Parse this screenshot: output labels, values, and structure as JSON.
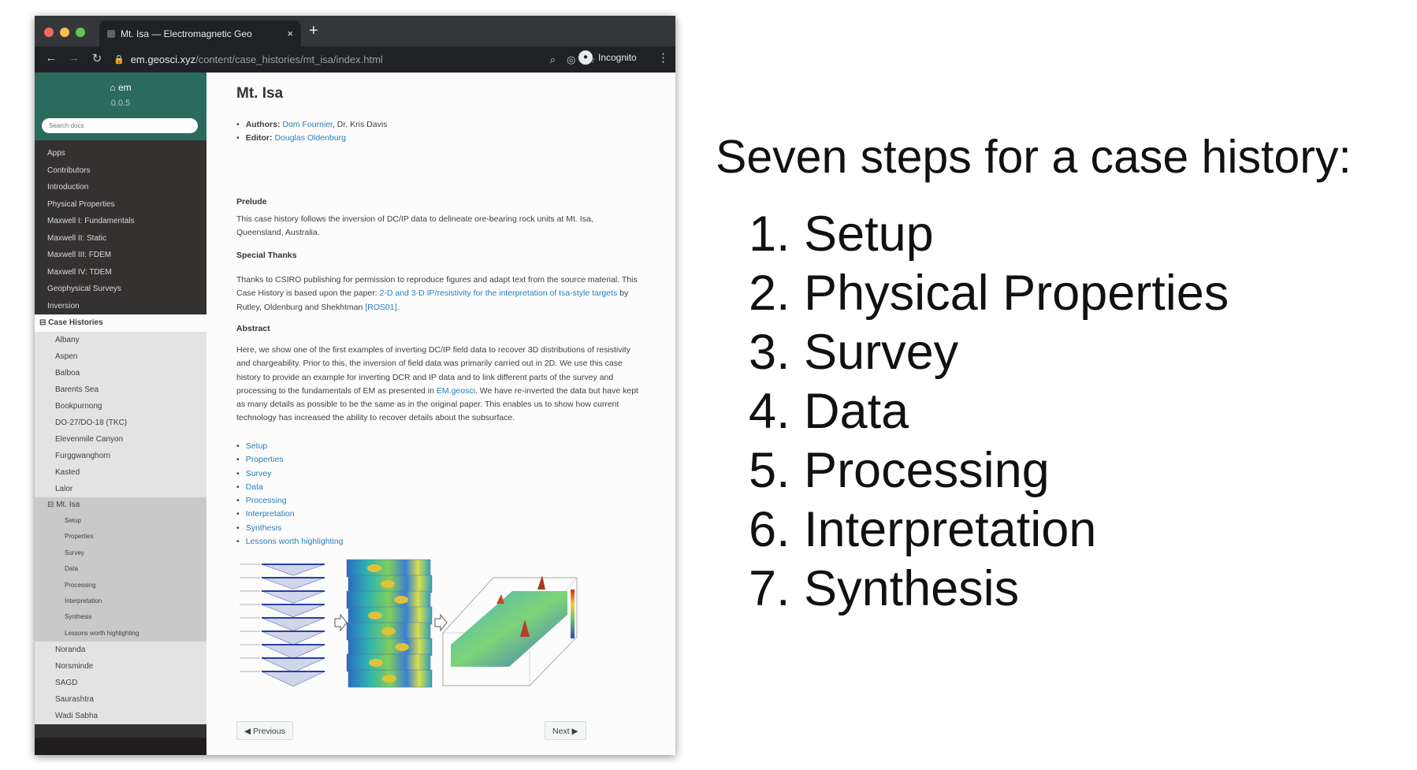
{
  "browser": {
    "tab_title": "Mt. Isa — Electromagnetic Geo",
    "tab_close": "×",
    "new_tab": "+",
    "url_host": "em.geosci.xyz",
    "url_path": "/content/case_histories/mt_isa/index.html",
    "incognito_label": "Incognito",
    "light_colors": [
      "#ed6a5e",
      "#f5bf4f",
      "#61c554"
    ]
  },
  "sidebar": {
    "home_label": "em",
    "version": "0.0.5",
    "search_placeholder": "Search docs",
    "top_items": [
      "Apps",
      "Contributors",
      "Introduction",
      "Physical Properties",
      "Maxwell I: Fundamentals",
      "Maxwell II: Static",
      "Maxwell III: FDEM",
      "Maxwell IV: TDEM",
      "Geophysical Surveys",
      "Inversion"
    ],
    "case_histories_label": "Case Histories",
    "case_items_before": [
      "Albany",
      "Aspen",
      "Balboa",
      "Barents Sea",
      "Bookpurnong",
      "DO-27/DO-18 (TKC)",
      "Elevenmile Canyon",
      "Furggwanghorn",
      "Kasted",
      "Lalor"
    ],
    "active_case": "Mt. Isa",
    "active_sub": [
      "Setup",
      "Properties",
      "Survey",
      "Data",
      "Processing",
      "Interpretation",
      "Synthesis",
      "Lessons worth highlighting"
    ],
    "case_items_after": [
      "Noranda",
      "Norsminde",
      "SAGD",
      "Saurashtra",
      "Wadi Sabha"
    ]
  },
  "content": {
    "title": "Mt. Isa",
    "authors_label": "Authors:",
    "author_1": "Dom Fournier",
    "author_sep": ",",
    "author_2": " Dr. Kris Davis",
    "editor_label": "Editor:",
    "editor": "Douglas Oldenburg",
    "prelude_heading": "Prelude",
    "prelude_text": "This case history follows the inversion of DC/IP data to delineate ore-bearing rock units at Mt. Isa, Queensland, Australia.",
    "thanks_heading": "Special Thanks",
    "thanks_pre": "Thanks to CSIRO publishing for permission to reproduce figures and adapt text from the source material. This Case History is based upon the paper: ",
    "thanks_link": "2-D and 3-D IP/resistivity for the interpretation of Isa-style targets",
    "thanks_mid": " by Rutley, Oldenburg and Shekhtman ",
    "thanks_ref": "[ROS01]",
    "thanks_end": ".",
    "abstract_heading": "Abstract",
    "abstract_pre": "Here, we show one of the first examples of inverting DC/IP field data to recover 3D distributions of resistivity and chargeability. Prior to this, the inversion of field data was primarily carried out in 2D. We use this case history to provide an example for inverting DCR and IP data and to link different parts of the survey and processing to the fundamentals of EM as presented in ",
    "abstract_link": "EM.geosci",
    "abstract_post": ". We have re-inverted the data but have kept as many details as possible to be the same as in the original paper. This enables us to show how current technology has increased the ability to recover details about the subsurface.",
    "toc": [
      "Setup",
      "Properties",
      "Survey",
      "Data",
      "Processing",
      "Interpretation",
      "Synthesis",
      "Lessons worth highlighting"
    ],
    "prev_label": "Previous",
    "next_label": "Next"
  },
  "slide": {
    "title": "Seven steps for a case history:",
    "steps": [
      "1. Setup",
      "2. Physical Properties",
      "3. Survey",
      "4. Data",
      "5. Processing",
      "6. Interpretation",
      "7. Synthesis"
    ]
  }
}
